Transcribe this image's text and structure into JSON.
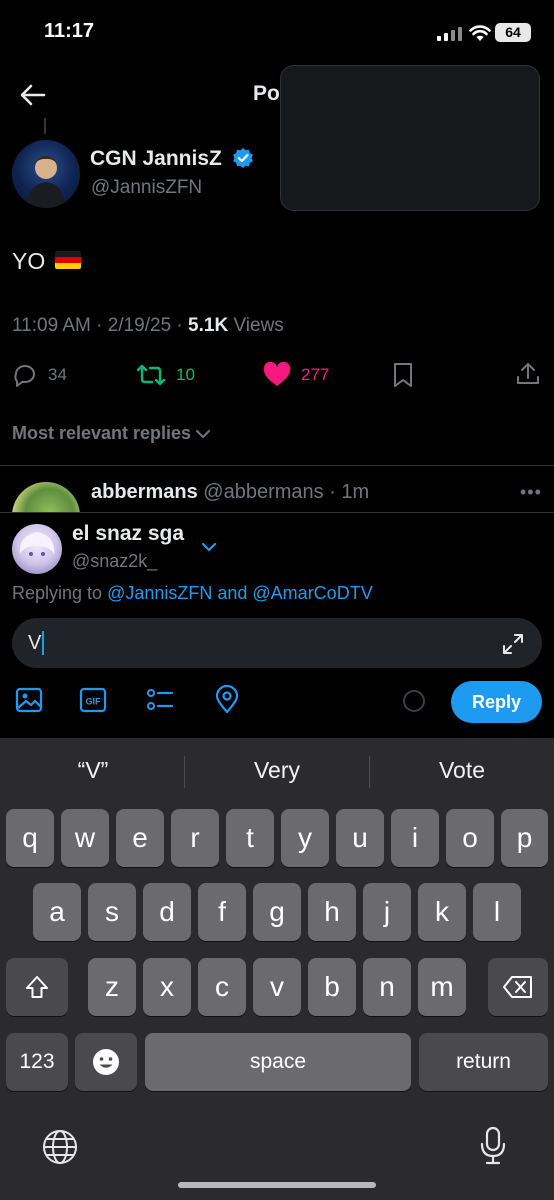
{
  "status_bar": {
    "time": "11:17",
    "battery": "64"
  },
  "header": {
    "title": "Post"
  },
  "tweet": {
    "author_name": "CGN JannisZ",
    "author_handle": "@JannisZFN",
    "text": "YO",
    "meta_prefix": "11:09 AM · 2/19/25 · ",
    "views_count": "5.1K",
    "views_label": " Views",
    "replies": "34",
    "retweets": "10",
    "likes": "277"
  },
  "replies_sort_label": "Most relevant replies",
  "reply_preview": {
    "name": "abbermans",
    "handle_time": " @abbermans · 1m"
  },
  "composer": {
    "name": "el snaz sga",
    "handle": "@snaz2k_",
    "replying_prefix": "Replying to ",
    "mention_1": "@JannisZFN",
    "mention_joiner": " and ",
    "mention_2": "@AmarCoDTV",
    "input_value": "V",
    "reply_button": "Reply"
  },
  "keyboard": {
    "suggestions": [
      "“V”",
      "Very",
      "Vote"
    ],
    "row1": [
      "q",
      "w",
      "e",
      "r",
      "t",
      "y",
      "u",
      "i",
      "o",
      "p"
    ],
    "row2": [
      "a",
      "s",
      "d",
      "f",
      "g",
      "h",
      "j",
      "k",
      "l"
    ],
    "row3": [
      "z",
      "x",
      "c",
      "v",
      "b",
      "n",
      "m"
    ],
    "numbers_key": "123",
    "space_key": "space",
    "return_key": "return"
  },
  "colors": {
    "accent": "#1d9bf0",
    "retweet": "#00ba7c",
    "like": "#f91880",
    "muted": "#71767b"
  }
}
